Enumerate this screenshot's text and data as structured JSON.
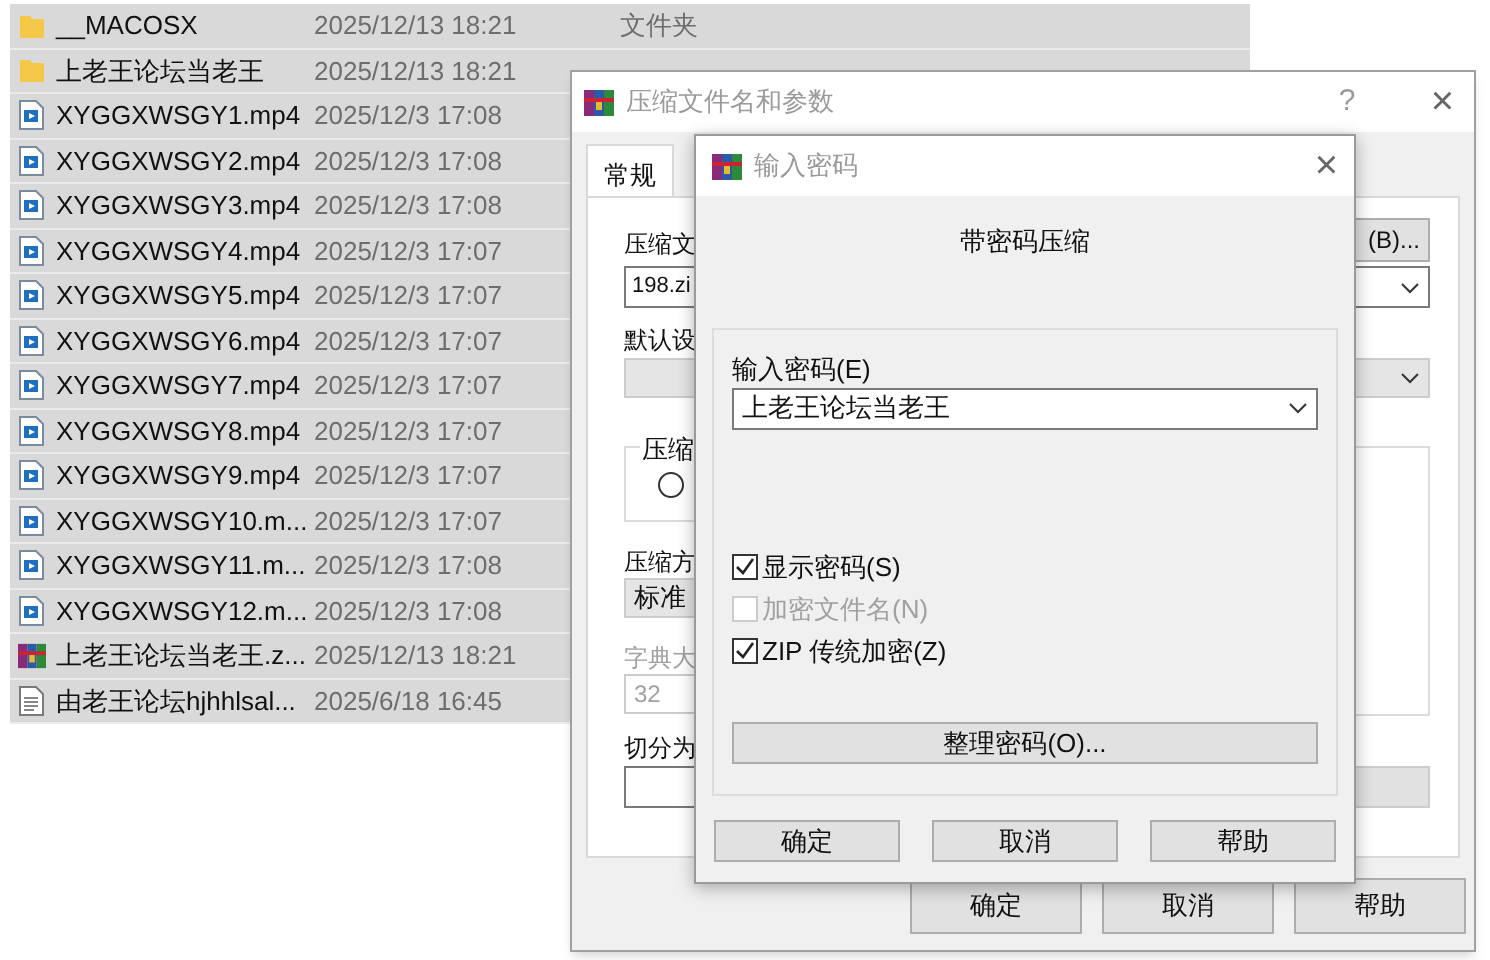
{
  "file_list": {
    "rows": [
      {
        "kind": "folder",
        "name": "__MACOSX",
        "modified": "2025/12/13 18:21",
        "type": "文件夹",
        "selected": true
      },
      {
        "kind": "folder",
        "name": "上老王论坛当老王",
        "modified": "2025/12/13 18:21",
        "selected": true
      },
      {
        "kind": "video",
        "name": "XYGGXWSGY1.mp4",
        "modified": "2025/12/3 17:08",
        "selected": true
      },
      {
        "kind": "video",
        "name": "XYGGXWSGY2.mp4",
        "modified": "2025/12/3 17:08",
        "selected": true
      },
      {
        "kind": "video",
        "name": "XYGGXWSGY3.mp4",
        "modified": "2025/12/3 17:08",
        "selected": true
      },
      {
        "kind": "video",
        "name": "XYGGXWSGY4.mp4",
        "modified": "2025/12/3 17:07",
        "selected": true
      },
      {
        "kind": "video",
        "name": "XYGGXWSGY5.mp4",
        "modified": "2025/12/3 17:07",
        "selected": true
      },
      {
        "kind": "video",
        "name": "XYGGXWSGY6.mp4",
        "modified": "2025/12/3 17:07",
        "selected": true
      },
      {
        "kind": "video",
        "name": "XYGGXWSGY7.mp4",
        "modified": "2025/12/3 17:07",
        "selected": true
      },
      {
        "kind": "video",
        "name": "XYGGXWSGY8.mp4",
        "modified": "2025/12/3 17:07",
        "selected": true
      },
      {
        "kind": "video",
        "name": "XYGGXWSGY9.mp4",
        "modified": "2025/12/3 17:07",
        "selected": true
      },
      {
        "kind": "video",
        "name": "XYGGXWSGY10.m...",
        "modified": "2025/12/3 17:07",
        "selected": true
      },
      {
        "kind": "video",
        "name": "XYGGXWSGY11.m...",
        "modified": "2025/12/3 17:08",
        "selected": true
      },
      {
        "kind": "video",
        "name": "XYGGXWSGY12.m...",
        "modified": "2025/12/3 17:08",
        "selected": true
      },
      {
        "kind": "archive",
        "name": "上老王论坛当老王.z...",
        "modified": "2025/12/13 18:21",
        "selected": true
      },
      {
        "kind": "text",
        "name": "由老王论坛hjhhlsal...",
        "modified": "2025/6/18 16:45",
        "selected": true
      }
    ]
  },
  "compress_dialog": {
    "title": "压缩文件名和参数",
    "help": "?",
    "close": "×",
    "tabs": [
      {
        "label": "常规",
        "selected": true
      }
    ],
    "archive_name_label": "压缩文",
    "browse_button": "(B)...",
    "archive_name": "198.zi",
    "profile_label": "默认设",
    "format_group": "压缩",
    "format_option_selected": false,
    "method_label": "压缩方",
    "method": "标准",
    "dictionary_label": "字典大",
    "dictionary": "32",
    "dictionary_disabled": true,
    "split_label": "切分为",
    "buttons": [
      "确定",
      "取消",
      "帮助"
    ]
  },
  "password_dialog": {
    "title": "输入密码",
    "close": "×",
    "heading": "带密码压缩",
    "password_label": "输入密码(E)",
    "password": "上老王论坛当老王",
    "options": [
      {
        "label": "显示密码(S)",
        "checked": true,
        "disabled": false
      },
      {
        "label": "加密文件名(N)",
        "checked": false,
        "disabled": true
      },
      {
        "label": "ZIP 传统加密(Z)",
        "checked": true,
        "disabled": false
      }
    ],
    "organize_button": "整理密码(O)...",
    "buttons": [
      "确定",
      "取消",
      "帮助"
    ]
  }
}
